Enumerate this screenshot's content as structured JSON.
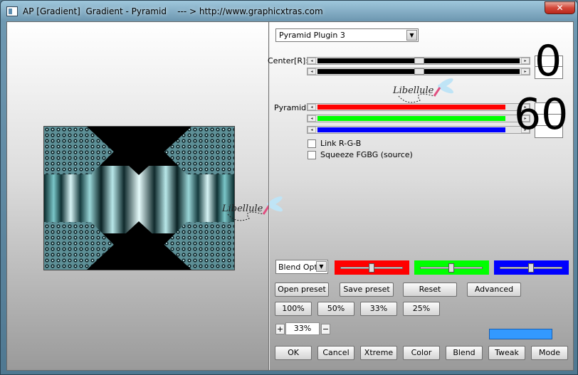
{
  "window": {
    "title": "AP [Gradient]  Gradient - Pyramid    --- > http://www.graphicxtras.com",
    "close_glyph": "✕"
  },
  "plugin_dropdown": {
    "selected": "Pyramid Plugin 3",
    "arrow": "▼"
  },
  "center": {
    "label": "Center[R]:",
    "big_value": "0",
    "slider_levels": [
      0.58,
      0.58
    ]
  },
  "pyramid": {
    "label": "Pyramid:",
    "big_value": "60",
    "slider_colors": [
      "#ff0000",
      "#00ff00",
      "#0000ff"
    ],
    "slider_levels": [
      0.97,
      0.97,
      0.97
    ]
  },
  "watermark_text": "Libellule",
  "options": {
    "link_rgb": {
      "label": "Link R-G-B",
      "checked": false
    },
    "squeeze": {
      "label": "Squeeze FGBG (source)",
      "checked": false
    }
  },
  "blend_options": {
    "selected": "Blend Optio",
    "arrow": "▼"
  },
  "color_panels": [
    {
      "color": "#ff0000",
      "level": 0.5
    },
    {
      "color": "#00ff00",
      "level": 0.5
    },
    {
      "color": "#0000ff",
      "level": 0.5
    }
  ],
  "buttons_row1": {
    "open_preset": "Open preset",
    "save_preset": "Save preset",
    "reset": "Reset",
    "advanced": "Advanced"
  },
  "zoom_buttons": [
    "100%",
    "50%",
    "33%",
    "25%"
  ],
  "zoom_stepper": {
    "plus": "+",
    "value": "33%",
    "minus": "−"
  },
  "swatch_color": "#3399ff",
  "bottom_buttons": {
    "ok": "OK",
    "cancel": "Cancel",
    "xtreme": "Xtreme",
    "color": "Color",
    "blend": "Blend",
    "tweak": "Tweak",
    "mode": "Mode"
  }
}
